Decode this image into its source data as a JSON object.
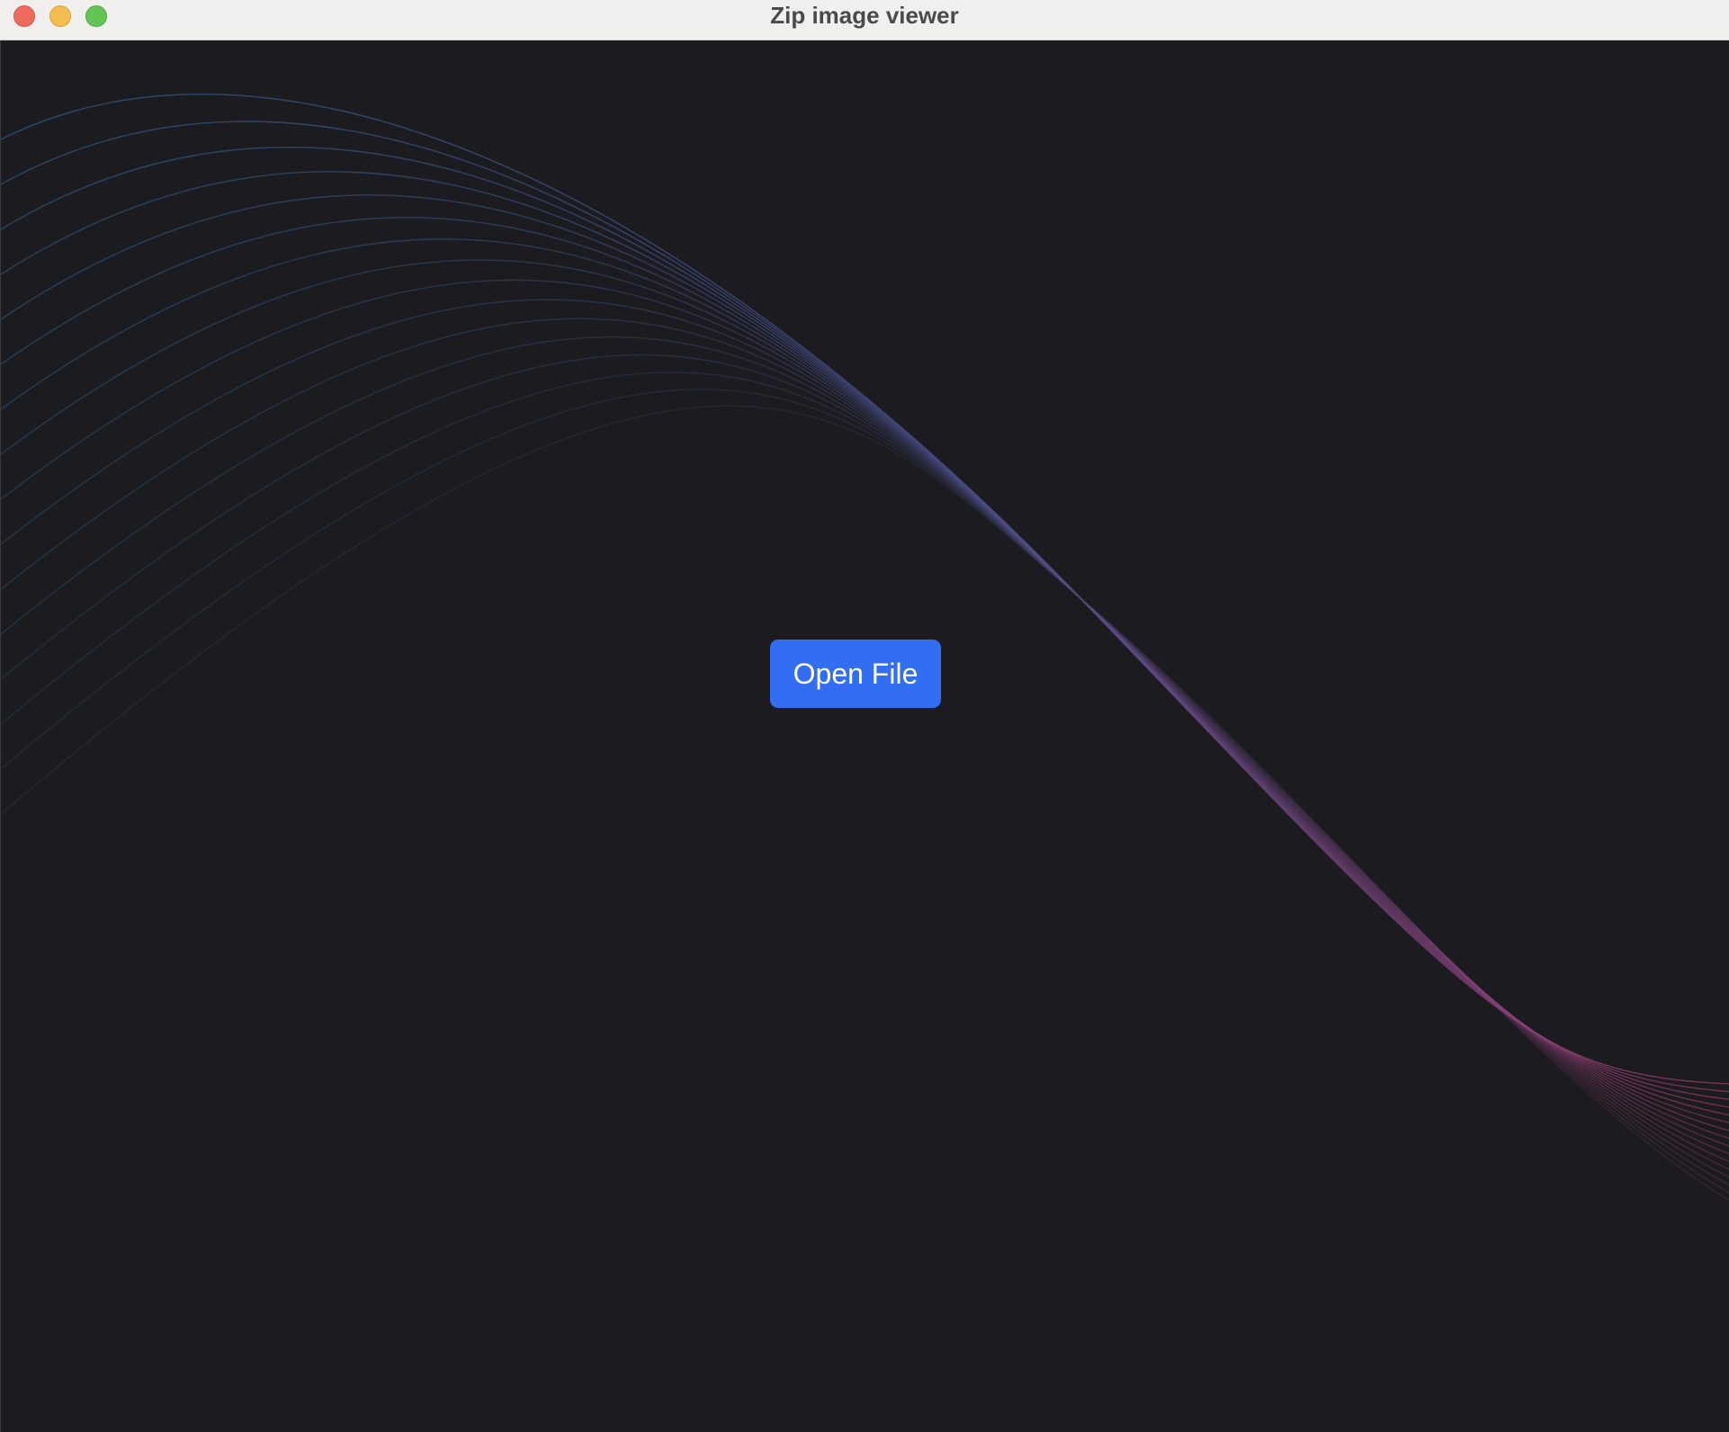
{
  "window": {
    "title": "Zip image viewer"
  },
  "main": {
    "open_button_label": "Open File"
  },
  "colors": {
    "background": "#1c1c20",
    "accent": "#316ef2",
    "wave_start": "#2e5a86",
    "wave_end": "#a03a6e"
  }
}
